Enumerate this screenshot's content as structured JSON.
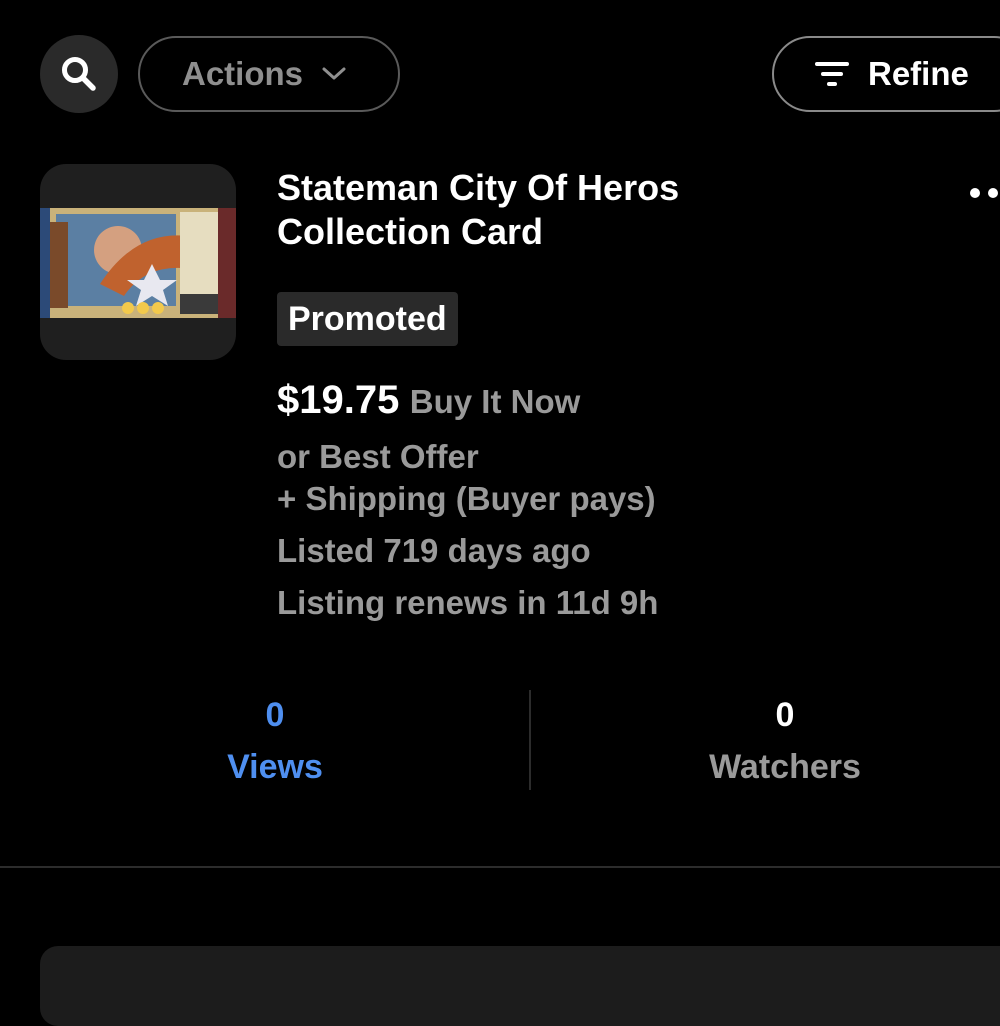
{
  "toolbar": {
    "actions_label": "Actions",
    "refine_label": "Refine"
  },
  "listing": {
    "title_line1": "Stateman City Of Heros",
    "title_line2": "Collection Card",
    "badge": "Promoted",
    "price": "$19.75",
    "format": "Buy It Now",
    "offer": "or Best Offer",
    "shipping": "+ Shipping (Buyer pays)",
    "listed": "Listed 719 days ago",
    "renews": "Listing renews in 11d 9h"
  },
  "stats": {
    "views_count": "0",
    "views_label": "Views",
    "watchers_count": "0",
    "watchers_label": "Watchers"
  },
  "colors": {
    "background": "#000000",
    "accent_blue": "#4f8ff0",
    "muted_text": "#9a9a9a"
  }
}
